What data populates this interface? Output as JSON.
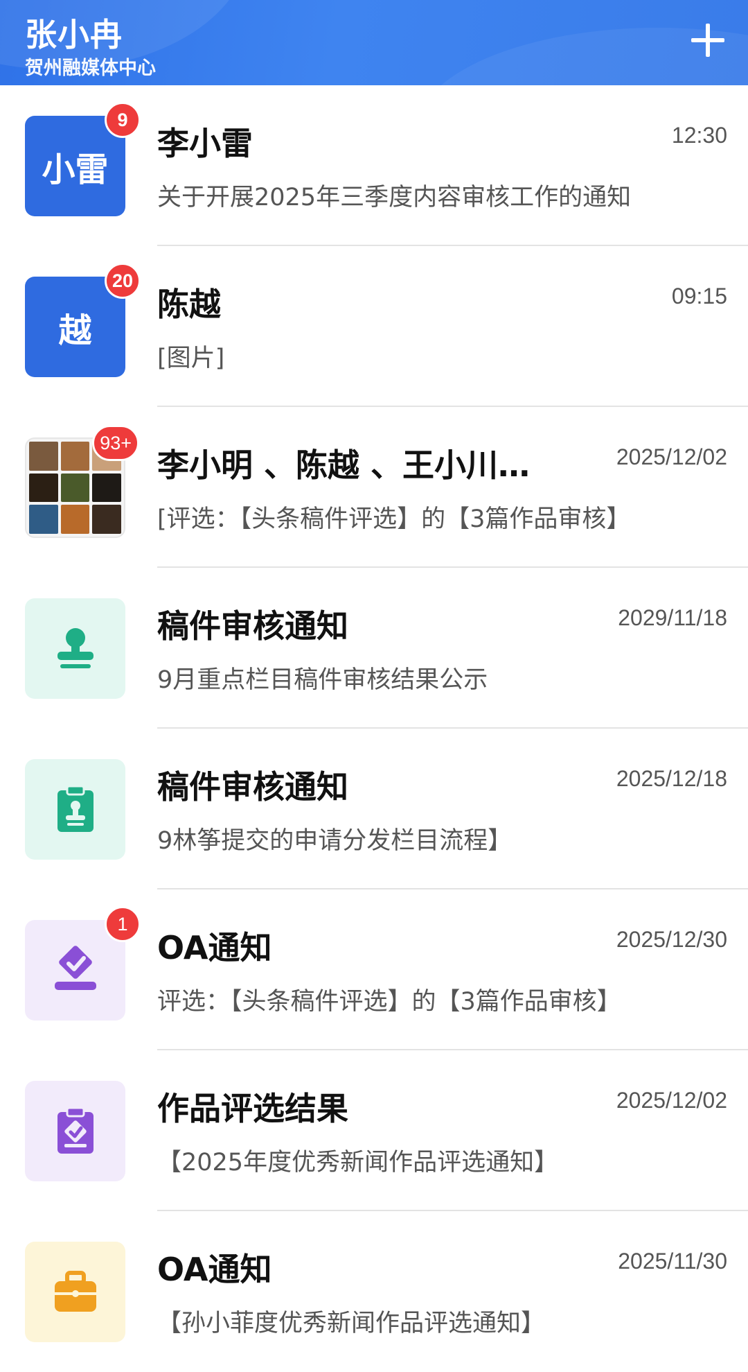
{
  "header": {
    "user_name": "张小冉",
    "org_name": "贺州融媒体中心",
    "add_icon": "plus-icon"
  },
  "conversations": [
    {
      "avatar_text": "小雷",
      "avatar_type": "text",
      "avatar_color": "#2f6be0",
      "badge": "9",
      "title": "李小雷",
      "time": "12:30",
      "preview": "关于开展2025年三季度内容审核工作的通知"
    },
    {
      "avatar_text": "越",
      "avatar_type": "text",
      "avatar_color": "#2f6be0",
      "badge": "20",
      "title": "陈越",
      "time": "09:15",
      "preview": "[图片]"
    },
    {
      "avatar_type": "photo-grid",
      "badge": "93+",
      "title": "李小明 、陈越 、王小川…",
      "time": "2025/12/02",
      "preview": "[评选：【头条稿件评选】的【3篇作品审核】"
    },
    {
      "avatar_type": "icon",
      "icon": "stamp-icon",
      "icon_color": "#1fae86",
      "badge": "",
      "title": "稿件审核通知",
      "time": "2029/11/18",
      "preview": "9月重点栏目稿件审核结果公示"
    },
    {
      "avatar_type": "icon",
      "icon": "clipboard-stamp-icon",
      "icon_color": "#1fae86",
      "badge": "",
      "title": "稿件审核通知",
      "time": "2025/12/18",
      "preview": "9林筝提交的申请分发栏目流程】"
    },
    {
      "avatar_type": "icon",
      "icon": "vote-check-icon",
      "icon_color": "#8a4fd6",
      "badge": "1",
      "title": "OA通知",
      "time": "2025/12/30",
      "preview": "评选：【头条稿件评选】的【3篇作品审核】"
    },
    {
      "avatar_type": "icon",
      "icon": "clipboard-check-icon",
      "icon_color": "#8a4fd6",
      "badge": "",
      "title": "作品评选结果",
      "time": "2025/12/02",
      "preview": "【2025年度优秀新闻作品评选通知】"
    },
    {
      "avatar_type": "icon",
      "icon": "briefcase-icon",
      "icon_color": "#f0a020",
      "badge": "",
      "title": "OA通知",
      "time": "2025/11/30",
      "preview": "【孙小菲度优秀新闻作品评选通知】"
    }
  ]
}
